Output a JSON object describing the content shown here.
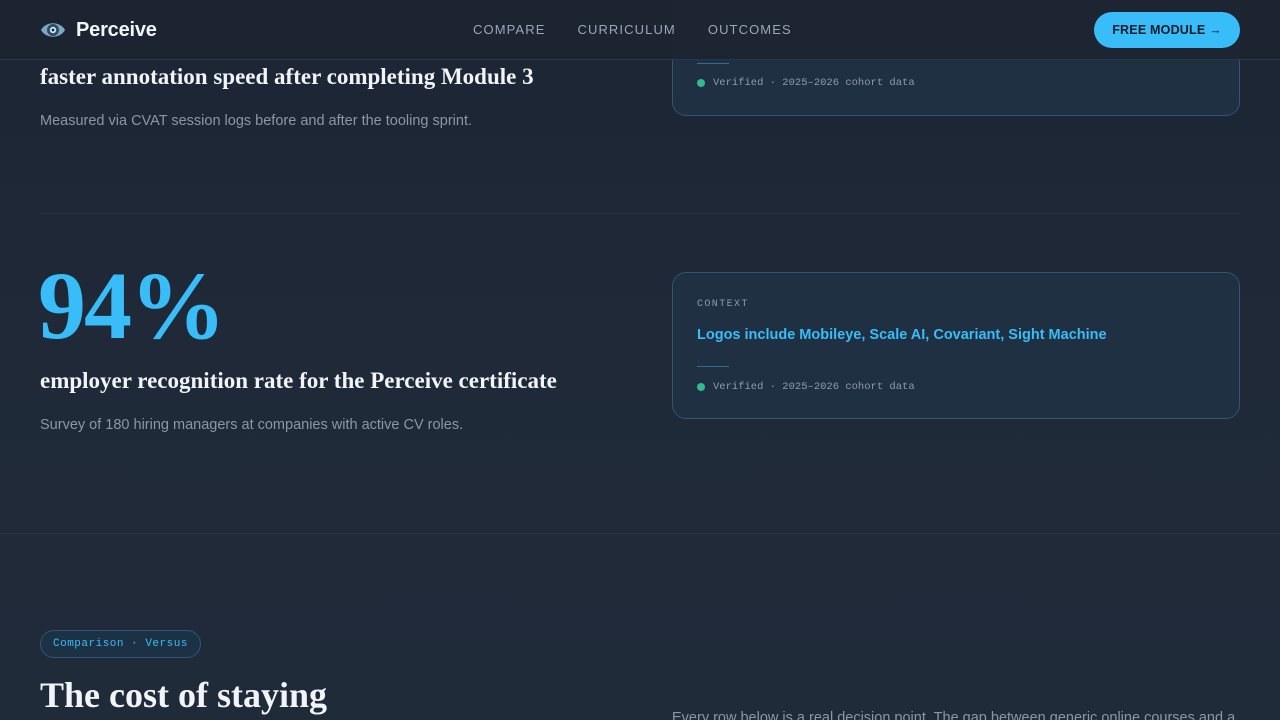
{
  "nav": {
    "brand": "Perceive",
    "links": [
      "COMPARE",
      "CURRICULUM",
      "OUTCOMES"
    ],
    "cta": "FREE MODULE →"
  },
  "stats": [
    {
      "title": "faster annotation speed after completing Module 3",
      "subtitle": "Measured via CVAT session logs before and after the tooling sprint.",
      "card": {
        "verified": "Verified · 2025–2026 cohort data"
      }
    },
    {
      "number": "94%",
      "title": "employer recognition rate for the Perceive certificate",
      "subtitle": "Survey of 180 hiring managers at companies with active CV roles.",
      "card": {
        "label": "CONTEXT",
        "text": "Logos include Mobileye, Scale AI, Covariant, Sight Machine",
        "verified": "Verified · 2025–2026 cohort data"
      }
    }
  ],
  "comparison": {
    "pill": "Comparison · Versus",
    "title": "The cost of staying",
    "lede": "Every row below is a real decision point. The gap between generic online courses and a"
  },
  "colors": {
    "accent": "#38bdf8",
    "verified": "#34b98a",
    "background": "#1e2937"
  }
}
